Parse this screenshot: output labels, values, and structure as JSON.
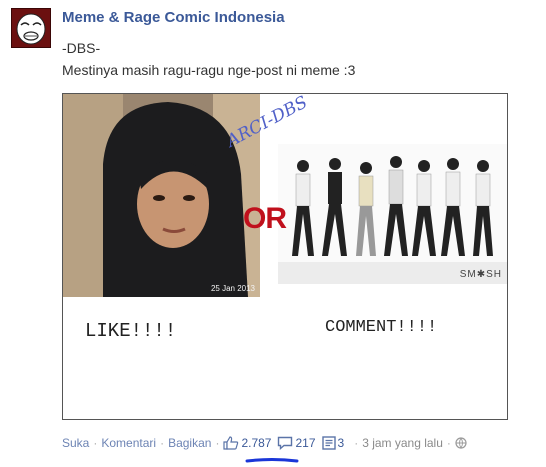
{
  "post": {
    "page_name": "Meme & Rage Comic Indonesia",
    "line1": "-DBS-",
    "line2": "Mestinya masih ragu-ragu nge-post ni meme :3"
  },
  "image": {
    "watermark": "ARCI-DBS",
    "date_stamp": "25 Jan 2013",
    "or_text": "OR",
    "group_logo": "SM✱SH",
    "like_text": "LIKE!!!!",
    "comment_text": "COMMENT!!!!"
  },
  "actions": {
    "like": "Suka",
    "comment": "Komentari",
    "share": "Bagikan",
    "likes_count": "2.787",
    "comments_count": "217",
    "shares_count": "3",
    "time": "3 jam yang lalu",
    "separator": "·"
  },
  "colors": {
    "link": "#3b5998",
    "annotation_underline": "#1a36d8",
    "or_red": "#c0101c"
  }
}
